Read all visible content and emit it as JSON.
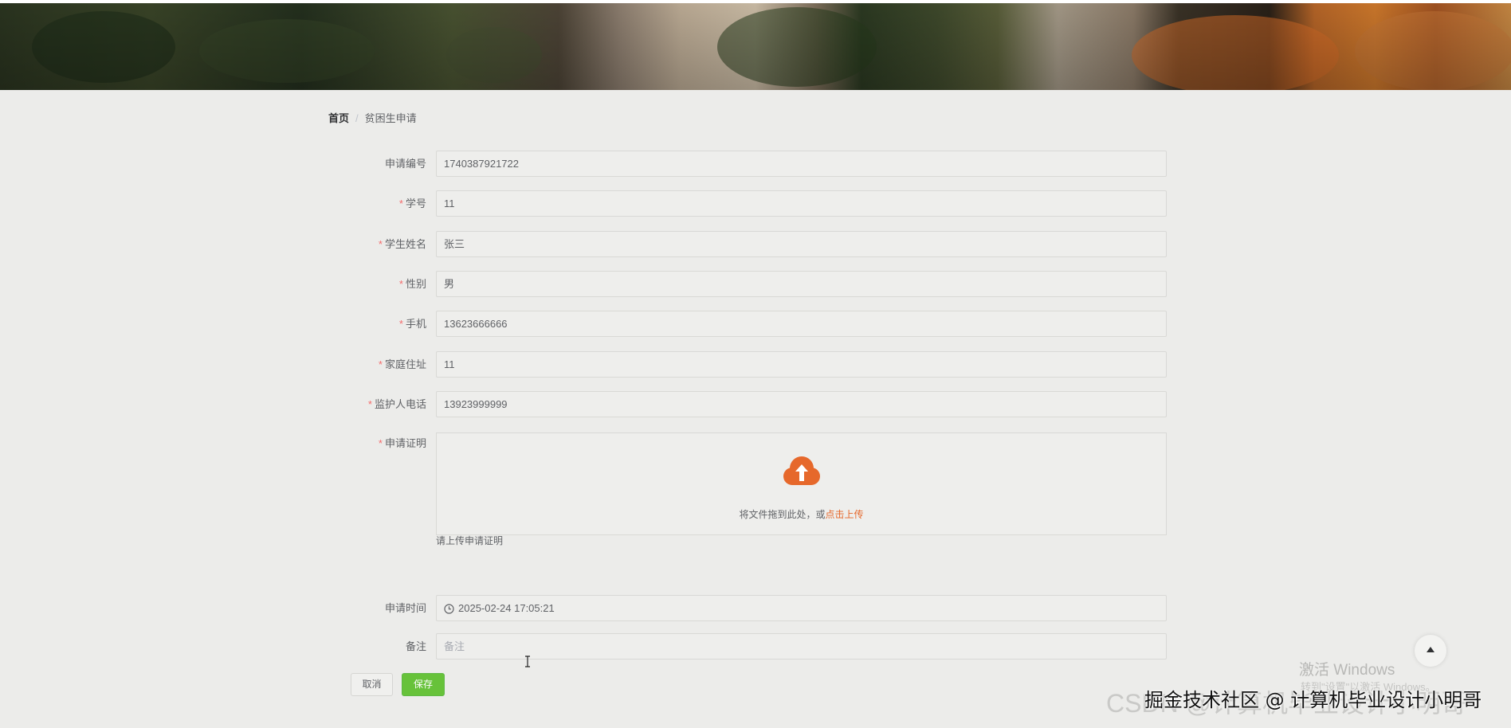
{
  "breadcrumb": {
    "home": "首页",
    "separator": "/",
    "current": "贫困生申请"
  },
  "form": {
    "apply_no": {
      "label": "申请编号",
      "value": "1740387921722"
    },
    "student_id": {
      "label": "学号",
      "value": "11"
    },
    "student_name": {
      "label": "学生姓名",
      "value": "张三"
    },
    "gender": {
      "label": "性别",
      "value": "男"
    },
    "phone": {
      "label": "手机",
      "value": "13623666666"
    },
    "home_address": {
      "label": "家庭住址",
      "value": "11"
    },
    "guardian_phone": {
      "label": "监护人电话",
      "value": "13923999999"
    },
    "proof": {
      "label": "申请证明",
      "upload_hint": "将文件拖到此处，或",
      "upload_link": "点击上传",
      "tip": "请上传申请证明"
    },
    "apply_time": {
      "label": "申请时间",
      "value": "2025-02-24 17:05:21"
    },
    "remark": {
      "label": "备注",
      "placeholder": "备注"
    },
    "required_mark": "*"
  },
  "buttons": {
    "cancel": "取消",
    "save": "保存"
  },
  "watermarks": {
    "windows_activate": "激活 Windows",
    "windows_sub": "转到\"设置\"以激活 Windows。",
    "csdn": "CSDN @计算机毕业设计小明哥",
    "juejin": "掘金技术社区 @ 计算机毕业设计小明哥"
  },
  "colors": {
    "accent": "#e6682b",
    "primary": "#67c23a",
    "required": "#f56c6c"
  }
}
